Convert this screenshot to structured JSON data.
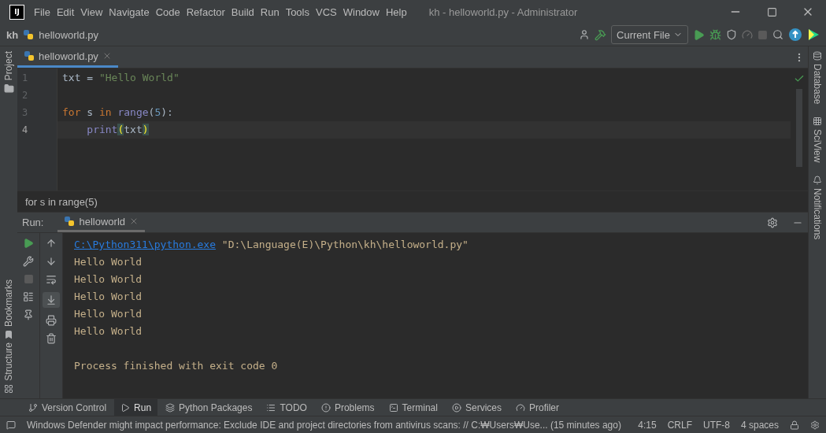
{
  "window": {
    "title": "kh - helloworld.py - Administrator",
    "logo": "IJ"
  },
  "menu": [
    "File",
    "Edit",
    "View",
    "Navigate",
    "Code",
    "Refactor",
    "Build",
    "Run",
    "Tools",
    "VCS",
    "Window",
    "Help"
  ],
  "navbar": {
    "crumbs": [
      {
        "text": "kh",
        "kind": "project"
      },
      {
        "text": "helloworld.py",
        "kind": "file"
      }
    ],
    "run_config": "Current File"
  },
  "left_tools": {
    "top": [
      "Project"
    ],
    "bottom": [
      "Bookmarks",
      "Structure"
    ]
  },
  "right_tools": [
    "Database",
    "SciView",
    "Notifications"
  ],
  "editor_tabs": [
    {
      "label": "helloworld.py",
      "selected": true
    }
  ],
  "editor": {
    "lines": [
      {
        "number": "1",
        "current": false,
        "tokens": [
          {
            "text": "txt = ",
            "kind": "plain"
          },
          {
            "text": "\"Hello World\"",
            "kind": "string"
          }
        ]
      },
      {
        "number": "2",
        "current": false
      },
      {
        "number": "3",
        "current": false,
        "tokens": [
          {
            "text": "for",
            "kind": "keyword"
          },
          {
            "text": " s ",
            "kind": "plain"
          },
          {
            "text": "in",
            "kind": "keyword"
          },
          {
            "text": " range",
            "kind": "builtin"
          },
          {
            "text": "(",
            "kind": "plain"
          },
          {
            "text": "5",
            "kind": "number"
          },
          {
            "text": "):",
            "kind": "plain"
          }
        ]
      },
      {
        "number": "4",
        "current": true,
        "tokens": [
          {
            "text": "    print",
            "kind": "builtin"
          },
          {
            "text": "(",
            "kind": "brace"
          },
          {
            "text": "txt",
            "kind": "plain"
          },
          {
            "text": ")",
            "kind": "brace"
          }
        ]
      }
    ],
    "breadcrumb": "for s in range(5)"
  },
  "run": {
    "label": "Run:",
    "tabs": [
      {
        "label": "helloworld",
        "selected": true
      }
    ],
    "output": [
      {
        "tokens": [
          {
            "text": "C:\\Python311\\python.exe",
            "kind": "link"
          },
          {
            "text": " \"D:\\Language(E)\\Python\\kh\\helloworld.py\"",
            "kind": "plain"
          }
        ]
      },
      {
        "tokens": [
          {
            "text": "Hello World",
            "kind": "plain"
          }
        ]
      },
      {
        "tokens": [
          {
            "text": "Hello World",
            "kind": "plain"
          }
        ]
      },
      {
        "tokens": [
          {
            "text": "Hello World",
            "kind": "plain"
          }
        ]
      },
      {
        "tokens": [
          {
            "text": "Hello World",
            "kind": "plain"
          }
        ]
      },
      {
        "tokens": [
          {
            "text": "Hello World",
            "kind": "plain"
          }
        ]
      }
    ],
    "exit_message": "Process finished with exit code 0"
  },
  "tool_tabs": [
    {
      "label": "Version Control",
      "selected": false
    },
    {
      "label": "Run",
      "selected": true
    },
    {
      "label": "Python Packages",
      "selected": false
    },
    {
      "label": "TODO",
      "selected": false
    },
    {
      "label": "Problems",
      "selected": false
    },
    {
      "label": "Terminal",
      "selected": false
    },
    {
      "label": "Services",
      "selected": false
    },
    {
      "label": "Profiler",
      "selected": false
    }
  ],
  "status_bar": {
    "message": "Windows Defender might impact performance: Exclude IDE and project directories from antivirus scans: // C:₩Users₩Use... (15 minutes ago)",
    "items": [
      "4:15",
      "CRLF",
      "UTF-8",
      "4 spaces"
    ]
  }
}
